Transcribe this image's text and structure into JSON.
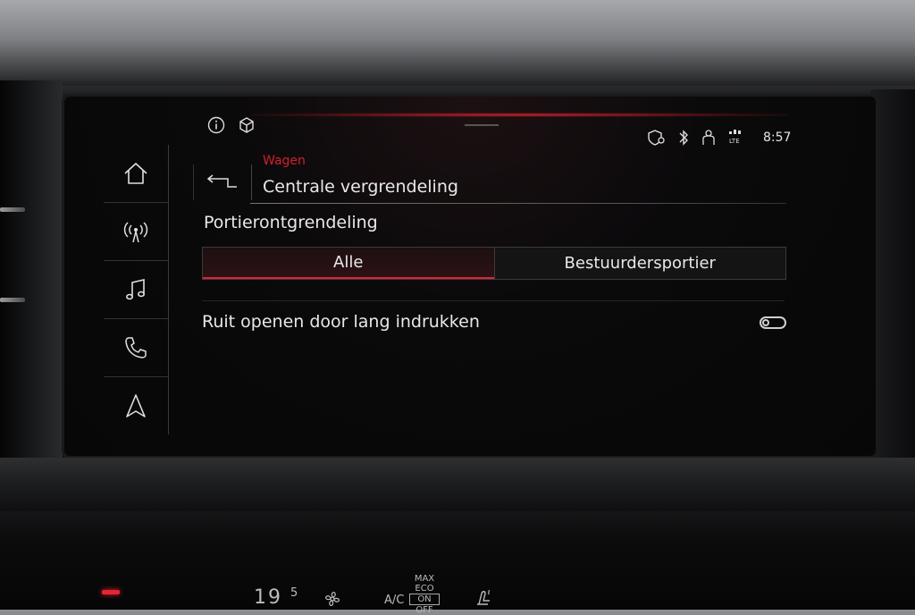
{
  "status_bar": {
    "left_icons": [
      "info-icon",
      "package-icon"
    ],
    "right_icons": [
      "location-shield-icon",
      "bluetooth-icon",
      "person-icon",
      "lte-signal-icon"
    ],
    "clock": "8:57"
  },
  "sidebar": {
    "items": [
      {
        "icon": "home-icon"
      },
      {
        "icon": "radio-icon"
      },
      {
        "icon": "music-icon"
      },
      {
        "icon": "phone-icon"
      },
      {
        "icon": "navigation-icon"
      }
    ]
  },
  "header": {
    "breadcrumb": "Wagen",
    "title": "Centrale vergrendeling"
  },
  "door_unlock": {
    "label": "Portierontgrendeling",
    "options": [
      "Alle",
      "Bestuurdersportier"
    ],
    "selected": "Alle"
  },
  "window_option": {
    "label": "Ruit openen door lang indrukken",
    "enabled": false
  },
  "climate": {
    "temp_main": "19",
    "temp_decimal": "5",
    "ac_label": "A/C",
    "eco_lines": [
      "MAX",
      "ECO",
      "ON",
      "OFF"
    ]
  },
  "colors": {
    "accent": "#e02433",
    "text": "#e8e8e8",
    "background": "#0a0a0a"
  }
}
